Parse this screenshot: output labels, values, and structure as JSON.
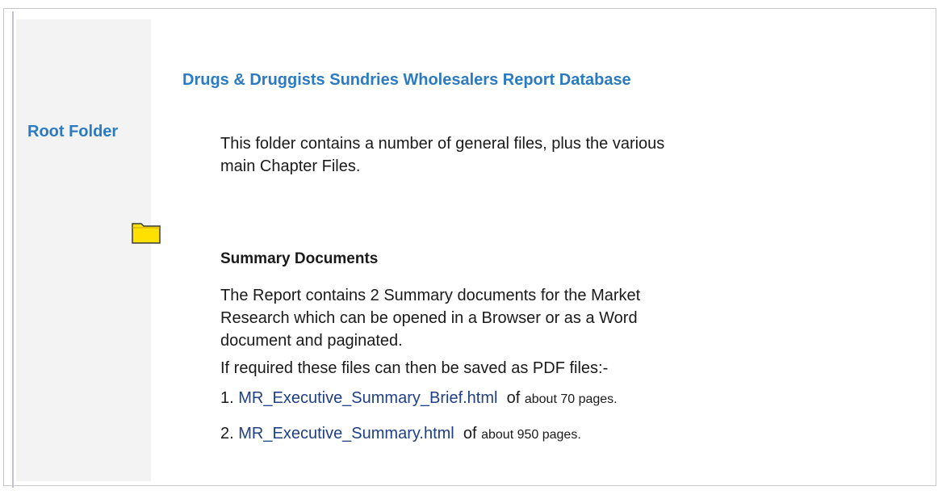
{
  "sidebar": {
    "folder_label": "Root Folder",
    "folder_icon": "folder-icon"
  },
  "main": {
    "title": "Drugs & Druggists Sundries Wholesalers Report Database",
    "intro": "This folder contains a number of general files, plus the various main Chapter Files.",
    "summary": {
      "heading": "Summary Documents",
      "description": "The Report contains 2 Summary documents for the Market Research which can be opened in a Browser or as a Word document and paginated.",
      "pdf_note": "If required these files can then be saved as PDF files:-",
      "files": [
        {
          "number": "1.",
          "name": "MR_Executive_Summary_Brief.html",
          "of": "of",
          "pages": "about 70 pages."
        },
        {
          "number": "2.",
          "name": "MR_Executive_Summary.html",
          "of": "of",
          "pages": "about 950 pages."
        }
      ]
    }
  },
  "colors": {
    "accent": "#2b7bc4",
    "link": "#1f3f86",
    "sidebar_bg": "#f3f3f3",
    "folder_fill": "#ffe000"
  }
}
